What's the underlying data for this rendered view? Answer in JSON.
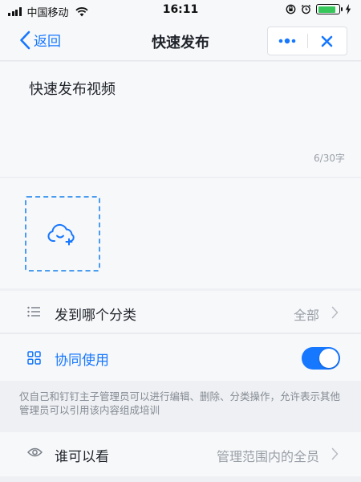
{
  "status_bar": {
    "carrier": "中国移动",
    "time": "16:11",
    "battery_level": 0.85
  },
  "nav": {
    "back_label": "返回",
    "title": "快速发布",
    "more_icon": "more-dots-icon",
    "close_icon": "close-icon"
  },
  "editor": {
    "title_text": "快速发布视频",
    "char_count": "6/30字"
  },
  "upload": {
    "icon": "cloud-upload-icon"
  },
  "category_row": {
    "icon": "list-icon",
    "label": "发到哪个分类",
    "value": "全部"
  },
  "collab_row": {
    "icon": "grid-icon",
    "label": "协同使用",
    "toggle_on": true
  },
  "help": {
    "text": "仅自己和钉钉主子管理员可以进行编辑、删除、分类操作，允许表示其他管理员可以引用该内容组成培训"
  },
  "viewer_row": {
    "icon": "eye-icon",
    "label": "谁可以看",
    "value": "管理范围内的全员"
  },
  "colors": {
    "accent": "#1677ff",
    "background": "#eef0f3",
    "panel": "#f7f8fa",
    "muted_text": "#9aa0a8"
  }
}
